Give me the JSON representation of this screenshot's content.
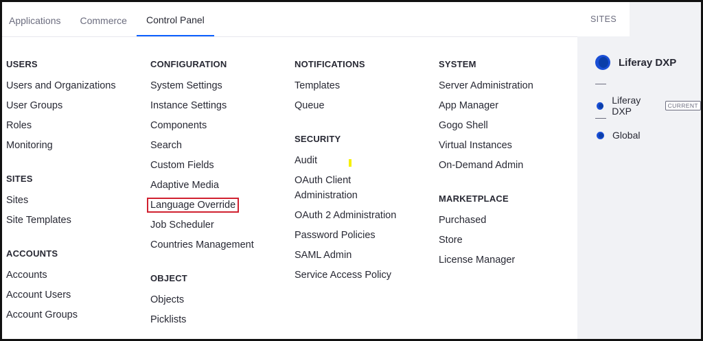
{
  "tabs": [
    {
      "label": "Applications"
    },
    {
      "label": "Commerce"
    },
    {
      "label": "Control Panel"
    }
  ],
  "columns": [
    {
      "sections": [
        {
          "title": "USERS",
          "items": [
            "Users and Organizations",
            "User Groups",
            "Roles",
            "Monitoring"
          ]
        },
        {
          "title": "SITES",
          "items": [
            "Sites",
            "Site Templates"
          ]
        },
        {
          "title": "ACCOUNTS",
          "items": [
            "Accounts",
            "Account Users",
            "Account Groups"
          ]
        }
      ]
    },
    {
      "sections": [
        {
          "title": "CONFIGURATION",
          "items": [
            "System Settings",
            "Instance Settings",
            "Components",
            "Search",
            "Custom Fields",
            "Adaptive Media",
            "Language Override",
            "Job Scheduler",
            "Countries Management"
          ]
        },
        {
          "title": "OBJECT",
          "items": [
            "Objects",
            "Picklists"
          ]
        }
      ]
    },
    {
      "sections": [
        {
          "title": "NOTIFICATIONS",
          "items": [
            "Templates",
            "Queue"
          ]
        },
        {
          "title": "SECURITY",
          "items": [
            "Audit",
            "OAuth Client Administration",
            "OAuth 2 Administration",
            "Password Policies",
            "SAML Admin",
            "Service Access Policy"
          ]
        }
      ]
    },
    {
      "sections": [
        {
          "title": "SYSTEM",
          "items": [
            "Server Administration",
            "App Manager",
            "Gogo Shell",
            "Virtual Instances",
            "On-Demand Admin"
          ]
        },
        {
          "title": "MARKETPLACE",
          "items": [
            "Purchased",
            "Store",
            "License Manager"
          ]
        }
      ]
    }
  ],
  "sites_panel": {
    "tab_label": "SITES",
    "header_site": "Liferay DXP",
    "current_site": "Liferay DXP",
    "current_badge": "CURRENT",
    "global_site": "Global"
  },
  "colors": {
    "accent": "#0b5fff",
    "highlight_border": "#d0202f",
    "logo_blue": "#1a4fd6"
  }
}
